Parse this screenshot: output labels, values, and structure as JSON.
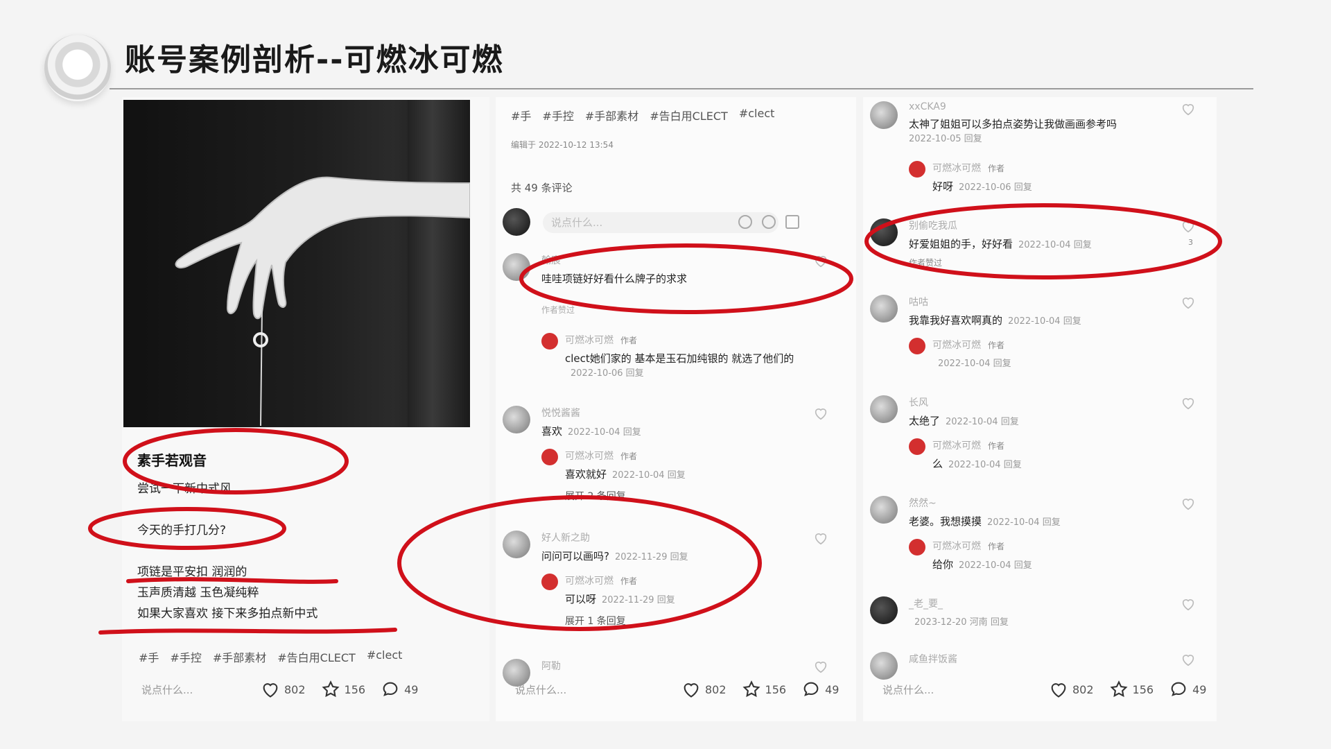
{
  "slide": {
    "title": "账号案例剖析--可燃冰可燃"
  },
  "post": {
    "title": "素手若观音",
    "lines": [
      "尝试一下新中式风",
      "今天的手打几分?",
      "项链是平安扣 润润的",
      "玉声质清越 玉色凝纯粹",
      "如果大家喜欢 接下来多拍点新中式"
    ],
    "tags": [
      "#手",
      "#手控",
      "#手部素材",
      "#告白用CLECT",
      "#clect"
    ]
  },
  "actions": {
    "say": "说点什么...",
    "likes": "802",
    "stars": "156",
    "comments": "49"
  },
  "panel1": {
    "tags": [
      "#手",
      "#手控",
      "#手部素材",
      "#告白用CLECT",
      "#clect"
    ],
    "edited": "编辑于 2022-10-12 13:54",
    "comment_count": "共 49 条评论",
    "input_placeholder": "说点什么...",
    "comments": [
      {
        "name": "翰宸",
        "text": "哇哇项链好好看什么牌子的求求",
        "note": "作者赞过",
        "reply": {
          "name": "可燃冰可燃",
          "badge": "作者",
          "text": "clect她们家的 基本是玉石加纯银的 就选了他们的",
          "date": "2022-10-06 回复"
        }
      },
      {
        "name": "悦悦酱酱",
        "text": "喜欢",
        "date": "2022-10-04 回复",
        "reply": {
          "name": "可燃冰可燃",
          "badge": "作者",
          "text": "喜欢就好",
          "date": "2022-10-04 回复"
        },
        "expand": "展开 2 条回复"
      },
      {
        "name": "好人新之助",
        "text": "问问可以画吗?",
        "date": "2022-11-29 回复",
        "reply": {
          "name": "可燃冰可燃",
          "badge": "作者",
          "text": "可以呀",
          "date": "2022-11-29 回复"
        },
        "expand": "展开 1 条回复"
      },
      {
        "name": "阿勒",
        "text": "",
        "date": ""
      }
    ]
  },
  "panel2": {
    "comments": [
      {
        "name": "xxCKA9",
        "text": "太神了姐姐可以多拍点姿势让我做画画参考吗",
        "date": "2022-10-05 回复",
        "reply": {
          "name": "可燃冰可燃",
          "badge": "作者",
          "text": "好呀",
          "date": "2022-10-06 回复"
        }
      },
      {
        "name": "别偷吃我瓜",
        "text": "好爱姐姐的手，好好看",
        "date": "2022-10-04 回复",
        "note": "作者赞过",
        "likes": "3"
      },
      {
        "name": "咕咕",
        "text": "我靠我好喜欢啊真的",
        "date": "2022-10-04 回复",
        "reply": {
          "name": "可燃冰可燃",
          "badge": "作者",
          "text": "",
          "date": "2022-10-04 回复"
        }
      },
      {
        "name": "长风",
        "text": "太绝了",
        "date": "2022-10-04 回复",
        "reply": {
          "name": "可燃冰可燃",
          "badge": "作者",
          "text": "么",
          "date": "2022-10-04 回复"
        }
      },
      {
        "name": "然然~",
        "text": "老婆。我想摸摸",
        "date": "2022-10-04 回复",
        "reply": {
          "name": "可燃冰可燃",
          "badge": "作者",
          "text": "给你",
          "date": "2022-10-04 回复"
        }
      },
      {
        "name": "_老_要_",
        "text": "",
        "date": "2023-12-20 河南 回复"
      },
      {
        "name": "咸鱼拌饭酱",
        "text": "",
        "date": ""
      }
    ]
  },
  "colors": {
    "annotation_red": "#d0101a",
    "author_avatar": "#d32f2f"
  }
}
